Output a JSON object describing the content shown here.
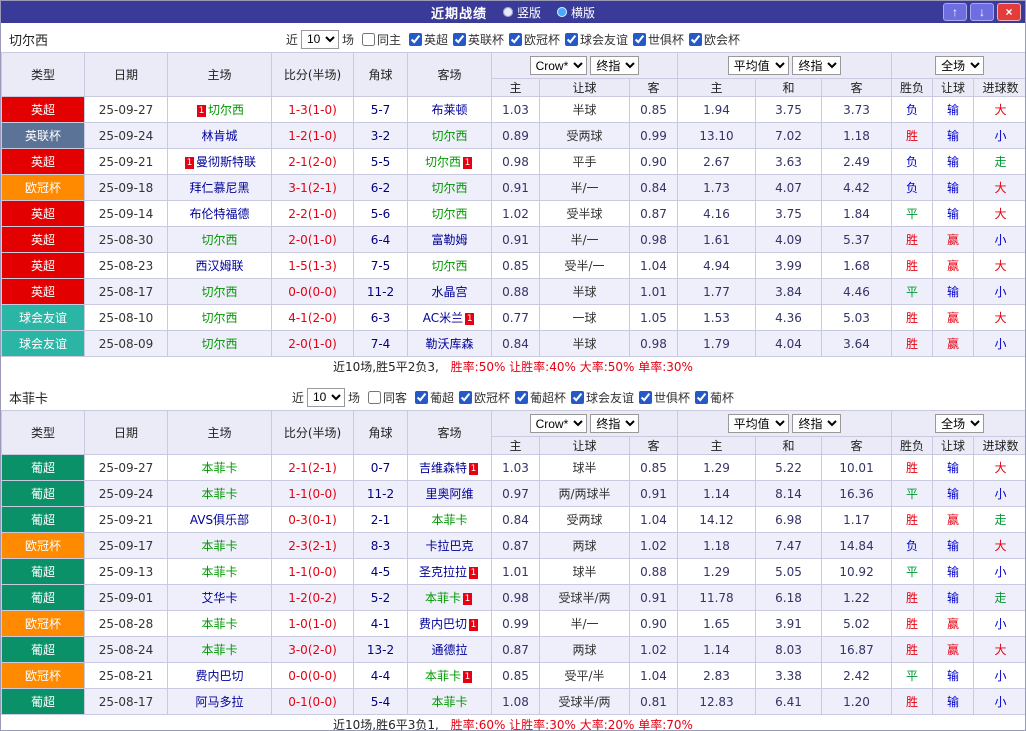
{
  "titlebar": {
    "title": "近期战绩",
    "vertical_label": "竖版",
    "horizontal_label": "横版",
    "selected_layout": "横版",
    "up_icon": "↑",
    "down_icon": "↓",
    "close_icon": "×"
  },
  "colors": {
    "titlebar_bg": "#3a3a99",
    "nav_button_bg": "#6e6ee0",
    "close_button_bg": "#e23c3c",
    "selected_team": "#009900",
    "team_link": "#000099",
    "score_red": "#e60012",
    "header_bg": "#ebebf7",
    "row_alt_bg": "#efeffb",
    "grid_border": "#c9c9df"
  },
  "league_colors": {
    "英超": "#e30000",
    "英联杯": "#5b7397",
    "欧冠杯": "#ff8a00",
    "球会友谊": "#2ab5a5",
    "葡超": "#0a9168"
  },
  "result_colors": {
    "胜": "#e60012",
    "平": "#009933",
    "负": "#0000cc",
    "赢": "#e60012",
    "输": "#0000cc",
    "大": "#e60012",
    "小": "#0000cc",
    "走": "#009933"
  },
  "sections": [
    {
      "team": "切尔西",
      "filter": {
        "near": "近",
        "count": "10",
        "games": "场",
        "same_label": "同主",
        "same_checked": false,
        "leagues": [
          {
            "label": "英超",
            "checked": true
          },
          {
            "label": "英联杯",
            "checked": true
          },
          {
            "label": "欧冠杯",
            "checked": true
          },
          {
            "label": "球会友谊",
            "checked": true
          },
          {
            "label": "世俱杯",
            "checked": true
          },
          {
            "label": "欧会杯",
            "checked": true
          }
        ]
      },
      "header": {
        "type": "类型",
        "date": "日期",
        "home": "主场",
        "score": "比分(半场)",
        "corner": "角球",
        "away": "客场",
        "odds_source": "Crow*",
        "odds_time": "终指",
        "euro_source": "平均值",
        "euro_time": "终指",
        "scope": "全场",
        "sub": [
          "主",
          "让球",
          "客",
          "主",
          "和",
          "客",
          "胜负",
          "让球",
          "进球数"
        ]
      },
      "rows": [
        {
          "lg": "英超",
          "dt": "25-09-27",
          "hm": {
            "n": "切尔西",
            "sel": true,
            "card": "1",
            "pos": "b"
          },
          "sc": "1-3(1-0)",
          "cn": "5-7",
          "aw": {
            "n": "布莱顿"
          },
          "o": [
            "1.03",
            "半球",
            "0.85"
          ],
          "a": [
            "1.94",
            "3.75",
            "3.73"
          ],
          "r": [
            "负",
            "输",
            "大"
          ]
        },
        {
          "lg": "英联杯",
          "dt": "25-09-24",
          "hm": {
            "n": "林肯城"
          },
          "sc": "1-2(1-0)",
          "cn": "3-2",
          "aw": {
            "n": "切尔西",
            "sel": true
          },
          "o": [
            "0.89",
            "受两球",
            "0.99"
          ],
          "a": [
            "13.10",
            "7.02",
            "1.18"
          ],
          "r": [
            "胜",
            "输",
            "小"
          ]
        },
        {
          "lg": "英超",
          "dt": "25-09-21",
          "hm": {
            "n": "曼彻斯特联",
            "card": "1",
            "pos": "b"
          },
          "sc": "2-1(2-0)",
          "cn": "5-5",
          "aw": {
            "n": "切尔西",
            "sel": true,
            "card": "1",
            "pos": "a"
          },
          "o": [
            "0.98",
            "平手",
            "0.90"
          ],
          "a": [
            "2.67",
            "3.63",
            "2.49"
          ],
          "r": [
            "负",
            "输",
            "走"
          ]
        },
        {
          "lg": "欧冠杯",
          "dt": "25-09-18",
          "hm": {
            "n": "拜仁慕尼黑"
          },
          "sc": "3-1(2-1)",
          "cn": "6-2",
          "aw": {
            "n": "切尔西",
            "sel": true
          },
          "o": [
            "0.91",
            "半/一",
            "0.84"
          ],
          "a": [
            "1.73",
            "4.07",
            "4.42"
          ],
          "r": [
            "负",
            "输",
            "大"
          ]
        },
        {
          "lg": "英超",
          "dt": "25-09-14",
          "hm": {
            "n": "布伦特福德"
          },
          "sc": "2-2(1-0)",
          "cn": "5-6",
          "aw": {
            "n": "切尔西",
            "sel": true
          },
          "o": [
            "1.02",
            "受半球",
            "0.87"
          ],
          "a": [
            "4.16",
            "3.75",
            "1.84"
          ],
          "r": [
            "平",
            "输",
            "大"
          ]
        },
        {
          "lg": "英超",
          "dt": "25-08-30",
          "hm": {
            "n": "切尔西",
            "sel": true
          },
          "sc": "2-0(1-0)",
          "cn": "6-4",
          "aw": {
            "n": "富勒姆"
          },
          "o": [
            "0.91",
            "半/一",
            "0.98"
          ],
          "a": [
            "1.61",
            "4.09",
            "5.37"
          ],
          "r": [
            "胜",
            "赢",
            "小"
          ]
        },
        {
          "lg": "英超",
          "dt": "25-08-23",
          "hm": {
            "n": "西汉姆联"
          },
          "sc": "1-5(1-3)",
          "cn": "7-5",
          "aw": {
            "n": "切尔西",
            "sel": true
          },
          "o": [
            "0.85",
            "受半/一",
            "1.04"
          ],
          "a": [
            "4.94",
            "3.99",
            "1.68"
          ],
          "r": [
            "胜",
            "赢",
            "大"
          ]
        },
        {
          "lg": "英超",
          "dt": "25-08-17",
          "hm": {
            "n": "切尔西",
            "sel": true
          },
          "sc": "0-0(0-0)",
          "cn": "11-2",
          "aw": {
            "n": "水晶宫"
          },
          "o": [
            "0.88",
            "半球",
            "1.01"
          ],
          "a": [
            "1.77",
            "3.84",
            "4.46"
          ],
          "r": [
            "平",
            "输",
            "小"
          ]
        },
        {
          "lg": "球会友谊",
          "dt": "25-08-10",
          "hm": {
            "n": "切尔西",
            "sel": true
          },
          "sc": "4-1(2-0)",
          "cn": "6-3",
          "aw": {
            "n": "AC米兰",
            "card": "1",
            "pos": "a"
          },
          "o": [
            "0.77",
            "一球",
            "1.05"
          ],
          "a": [
            "1.53",
            "4.36",
            "5.03"
          ],
          "r": [
            "胜",
            "赢",
            "大"
          ]
        },
        {
          "lg": "球会友谊",
          "dt": "25-08-09",
          "hm": {
            "n": "切尔西",
            "sel": true
          },
          "sc": "2-0(1-0)",
          "cn": "7-4",
          "aw": {
            "n": "勒沃库森"
          },
          "o": [
            "0.84",
            "半球",
            "0.98"
          ],
          "a": [
            "1.79",
            "4.04",
            "3.64"
          ],
          "r": [
            "胜",
            "赢",
            "小"
          ]
        }
      ],
      "summary_plain": "近10场,胜5平2负3,",
      "summary_rates": "胜率:50% 让胜率:40% 大率:50% 单率:30%"
    },
    {
      "team": "本菲卡",
      "filter": {
        "near": "近",
        "count": "10",
        "games": "场",
        "same_label": "同客",
        "same_checked": false,
        "leagues": [
          {
            "label": "葡超",
            "checked": true
          },
          {
            "label": "欧冠杯",
            "checked": true
          },
          {
            "label": "葡超杯",
            "checked": true
          },
          {
            "label": "球会友谊",
            "checked": true
          },
          {
            "label": "世俱杯",
            "checked": true
          },
          {
            "label": "葡杯",
            "checked": true
          }
        ]
      },
      "header": {
        "type": "类型",
        "date": "日期",
        "home": "主场",
        "score": "比分(半场)",
        "corner": "角球",
        "away": "客场",
        "odds_source": "Crow*",
        "odds_time": "终指",
        "euro_source": "平均值",
        "euro_time": "终指",
        "scope": "全场",
        "sub": [
          "主",
          "让球",
          "客",
          "主",
          "和",
          "客",
          "胜负",
          "让球",
          "进球数"
        ]
      },
      "rows": [
        {
          "lg": "葡超",
          "dt": "25-09-27",
          "hm": {
            "n": "本菲卡",
            "sel": true
          },
          "sc": "2-1(2-1)",
          "cn": "0-7",
          "aw": {
            "n": "吉维森特",
            "card": "1",
            "pos": "a"
          },
          "o": [
            "1.03",
            "球半",
            "0.85"
          ],
          "a": [
            "1.29",
            "5.22",
            "10.01"
          ],
          "r": [
            "胜",
            "输",
            "大"
          ]
        },
        {
          "lg": "葡超",
          "dt": "25-09-24",
          "hm": {
            "n": "本菲卡",
            "sel": true
          },
          "sc": "1-1(0-0)",
          "cn": "11-2",
          "aw": {
            "n": "里奥阿维"
          },
          "o": [
            "0.97",
            "两/两球半",
            "0.91"
          ],
          "a": [
            "1.14",
            "8.14",
            "16.36"
          ],
          "r": [
            "平",
            "输",
            "小"
          ]
        },
        {
          "lg": "葡超",
          "dt": "25-09-21",
          "hm": {
            "n": "AVS俱乐部"
          },
          "sc": "0-3(0-1)",
          "cn": "2-1",
          "aw": {
            "n": "本菲卡",
            "sel": true
          },
          "o": [
            "0.84",
            "受两球",
            "1.04"
          ],
          "a": [
            "14.12",
            "6.98",
            "1.17"
          ],
          "r": [
            "胜",
            "赢",
            "走"
          ]
        },
        {
          "lg": "欧冠杯",
          "dt": "25-09-17",
          "hm": {
            "n": "本菲卡",
            "sel": true
          },
          "sc": "2-3(2-1)",
          "cn": "8-3",
          "aw": {
            "n": "卡拉巴克"
          },
          "o": [
            "0.87",
            "两球",
            "1.02"
          ],
          "a": [
            "1.18",
            "7.47",
            "14.84"
          ],
          "r": [
            "负",
            "输",
            "大"
          ]
        },
        {
          "lg": "葡超",
          "dt": "25-09-13",
          "hm": {
            "n": "本菲卡",
            "sel": true
          },
          "sc": "1-1(0-0)",
          "cn": "4-5",
          "aw": {
            "n": "圣克拉拉",
            "card": "1",
            "pos": "a"
          },
          "o": [
            "1.01",
            "球半",
            "0.88"
          ],
          "a": [
            "1.29",
            "5.05",
            "10.92"
          ],
          "r": [
            "平",
            "输",
            "小"
          ]
        },
        {
          "lg": "葡超",
          "dt": "25-09-01",
          "hm": {
            "n": "艾华卡"
          },
          "sc": "1-2(0-2)",
          "cn": "5-2",
          "aw": {
            "n": "本菲卡",
            "sel": true,
            "card": "1",
            "pos": "a"
          },
          "o": [
            "0.98",
            "受球半/两",
            "0.91"
          ],
          "a": [
            "11.78",
            "6.18",
            "1.22"
          ],
          "r": [
            "胜",
            "输",
            "走"
          ]
        },
        {
          "lg": "欧冠杯",
          "dt": "25-08-28",
          "hm": {
            "n": "本菲卡",
            "sel": true
          },
          "sc": "1-0(1-0)",
          "cn": "4-1",
          "aw": {
            "n": "费内巴切",
            "card": "1",
            "pos": "a"
          },
          "o": [
            "0.99",
            "半/一",
            "0.90"
          ],
          "a": [
            "1.65",
            "3.91",
            "5.02"
          ],
          "r": [
            "胜",
            "赢",
            "小"
          ]
        },
        {
          "lg": "葡超",
          "dt": "25-08-24",
          "hm": {
            "n": "本菲卡",
            "sel": true
          },
          "sc": "3-0(2-0)",
          "cn": "13-2",
          "aw": {
            "n": "通德拉"
          },
          "o": [
            "0.87",
            "两球",
            "1.02"
          ],
          "a": [
            "1.14",
            "8.03",
            "16.87"
          ],
          "r": [
            "胜",
            "赢",
            "大"
          ]
        },
        {
          "lg": "欧冠杯",
          "dt": "25-08-21",
          "hm": {
            "n": "费内巴切"
          },
          "sc": "0-0(0-0)",
          "cn": "4-4",
          "aw": {
            "n": "本菲卡",
            "sel": true,
            "card": "1",
            "pos": "a"
          },
          "o": [
            "0.85",
            "受平/半",
            "1.04"
          ],
          "a": [
            "2.83",
            "3.38",
            "2.42"
          ],
          "r": [
            "平",
            "输",
            "小"
          ]
        },
        {
          "lg": "葡超",
          "dt": "25-08-17",
          "hm": {
            "n": "阿马多拉"
          },
          "sc": "0-1(0-0)",
          "cn": "5-4",
          "aw": {
            "n": "本菲卡",
            "sel": true
          },
          "o": [
            "1.08",
            "受球半/两",
            "0.81"
          ],
          "a": [
            "12.83",
            "6.41",
            "1.20"
          ],
          "r": [
            "胜",
            "输",
            "小"
          ]
        }
      ],
      "summary_plain": "近10场,胜6平3负1,",
      "summary_rates": "胜率:60% 让胜率:30% 大率:20% 单率:70%"
    }
  ]
}
